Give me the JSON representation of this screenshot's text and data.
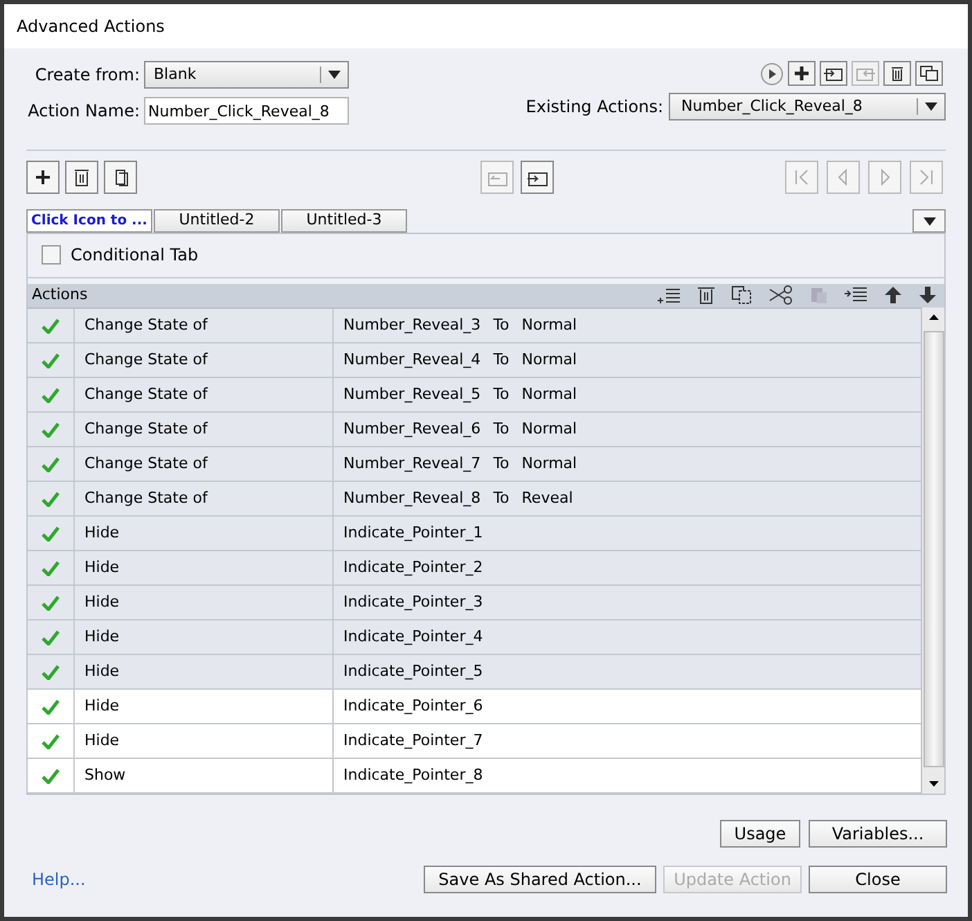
{
  "window": {
    "title": "Advanced Actions"
  },
  "create_from": {
    "label": "Create from:",
    "value": "Blank"
  },
  "action_name": {
    "label": "Action Name:",
    "value": "Number_Click_Reveal_8"
  },
  "existing_actions": {
    "label": "Existing Actions:",
    "value": "Number_Click_Reveal_8"
  },
  "tabs": [
    {
      "label": "Click Icon to ...",
      "selected": true
    },
    {
      "label": "Untitled-2",
      "selected": false
    },
    {
      "label": "Untitled-3",
      "selected": false
    }
  ],
  "conditional_tab": {
    "label": "Conditional Tab",
    "checked": false
  },
  "actions_header": "Actions",
  "rows": [
    {
      "checked": true,
      "selected": true,
      "action": "Change State of",
      "target": "Number_Reveal_3",
      "to": "To",
      "state": "Normal"
    },
    {
      "checked": true,
      "selected": true,
      "action": "Change State of",
      "target": "Number_Reveal_4",
      "to": "To",
      "state": "Normal"
    },
    {
      "checked": true,
      "selected": true,
      "action": "Change State of",
      "target": "Number_Reveal_5",
      "to": "To",
      "state": "Normal"
    },
    {
      "checked": true,
      "selected": true,
      "action": "Change State of",
      "target": "Number_Reveal_6",
      "to": "To",
      "state": "Normal"
    },
    {
      "checked": true,
      "selected": true,
      "action": "Change State of",
      "target": "Number_Reveal_7",
      "to": "To",
      "state": "Normal"
    },
    {
      "checked": true,
      "selected": true,
      "action": "Change State of",
      "target": "Number_Reveal_8",
      "to": "To",
      "state": "Reveal"
    },
    {
      "checked": true,
      "selected": true,
      "action": "Hide",
      "target": "Indicate_Pointer_1"
    },
    {
      "checked": true,
      "selected": true,
      "action": "Hide",
      "target": "Indicate_Pointer_2"
    },
    {
      "checked": true,
      "selected": true,
      "action": "Hide",
      "target": "Indicate_Pointer_3"
    },
    {
      "checked": true,
      "selected": true,
      "action": "Hide",
      "target": "Indicate_Pointer_4"
    },
    {
      "checked": true,
      "selected": true,
      "action": "Hide",
      "target": "Indicate_Pointer_5"
    },
    {
      "checked": true,
      "selected": false,
      "action": "Hide",
      "target": "Indicate_Pointer_6"
    },
    {
      "checked": true,
      "selected": false,
      "action": "Hide",
      "target": "Indicate_Pointer_7"
    },
    {
      "checked": true,
      "selected": false,
      "action": "Show",
      "target": "Indicate_Pointer_8"
    }
  ],
  "buttons": [
    {
      "label": "Usage",
      "disabled": false
    },
    {
      "label": "Variables...",
      "disabled": false
    }
  ],
  "help_link": "Help...",
  "footer_buttons": [
    {
      "label": "Save As Shared Action...",
      "disabled": false
    },
    {
      "label": "Update Action",
      "disabled": true
    },
    {
      "label": "Close",
      "disabled": false
    }
  ]
}
